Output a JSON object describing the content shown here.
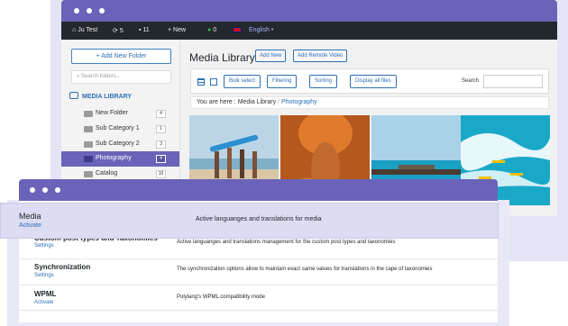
{
  "colors": {
    "accent": "#6a63b9",
    "link": "#2c6fb4",
    "admin_bar": "#23282d"
  },
  "admin_bar": {
    "site": "Ju Test",
    "updates": "5",
    "comments": "11",
    "new": "New",
    "notices": "0",
    "language": "English"
  },
  "sidebar": {
    "add_folder": "+ Add New Folder",
    "search_placeholder": "Search folders...",
    "library_label": "MEDIA LIBRARY",
    "folders": [
      {
        "label": "New Folder",
        "count": "4"
      },
      {
        "label": "Sub Category 1",
        "count": "1"
      },
      {
        "label": "Sub Category 2",
        "count": "3"
      },
      {
        "label": "Photography",
        "count": "4"
      },
      {
        "label": "Catalog",
        "count": "10"
      }
    ]
  },
  "main": {
    "title": "Media Library",
    "add_new": "Add New",
    "add_remote": "Add Remote Video",
    "toolbar": {
      "bulk": "Bulk select",
      "filtering": "Filtering",
      "sorting": "Sorting",
      "display_all": "Display all files",
      "search_label": "Search"
    },
    "breadcrumb": {
      "prefix": "You are here :",
      "root": "Media Library",
      "separator": "/",
      "current": "Photography"
    }
  },
  "settings": {
    "highlight": {
      "name": "Media",
      "action": "Activate",
      "desc": "Active languanges and translations for media"
    },
    "rows": [
      {
        "name": "Custom post types and Taxonomies",
        "action": "Settings",
        "desc": "Active languanges and translations management for the custom post types and taxonomies"
      },
      {
        "name": "Synchronization",
        "action": "Settings",
        "desc": "The synchronization options allow to maintain exact same values for translations in the cape of taxonomies"
      },
      {
        "name": "WPML",
        "action": "Activate",
        "desc": "Polylang's WPML compatibility mode"
      }
    ]
  }
}
